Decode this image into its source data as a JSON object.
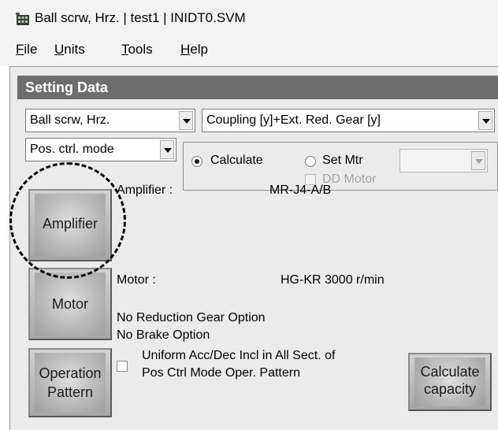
{
  "window": {
    "title": "Ball scrw, Hrz.  | test1 | INIDT0.SVM",
    "icon": "app-grid-icon"
  },
  "menu": [
    {
      "label": "File",
      "accel": "F"
    },
    {
      "label": "Units",
      "accel": "U"
    },
    {
      "label": "Tools",
      "accel": "T"
    },
    {
      "label": "Help",
      "accel": "H"
    }
  ],
  "section": {
    "title": "Setting Data"
  },
  "selects": {
    "mechanism": "Ball scrw, Hrz.",
    "coupling": "Coupling [y]+Ext. Red. Gear [y]",
    "control_mode": "Pos. ctrl. mode",
    "motor_select": ""
  },
  "calc_mode": {
    "calculate_label": "Calculate",
    "set_motor_label": "Set Mtr",
    "dd_motor_label": "DD Motor",
    "selected": "Calculate"
  },
  "amplifier": {
    "button_label": "Amplifier",
    "label": "Amplifier :",
    "value": "MR-J4-A/B"
  },
  "motor": {
    "button_label": "Motor",
    "label": "Motor :",
    "value": "HG-KR  3000 r/min",
    "gear_option": "No Reduction Gear Option",
    "brake_option": "No Brake Option"
  },
  "operation": {
    "button_line1": "Operation",
    "button_line2": "Pattern",
    "uniform_line1": "Uniform Acc/Dec Incl in All Sect. of",
    "uniform_line2": "Pos Ctrl Mode Oper. Pattern"
  },
  "calculate_capacity": {
    "line1": "Calculate",
    "line2": "capacity"
  },
  "colors": {
    "section_header": "#6d6d6d",
    "window_bg": "#ebebeb",
    "annotation": "#000000"
  }
}
